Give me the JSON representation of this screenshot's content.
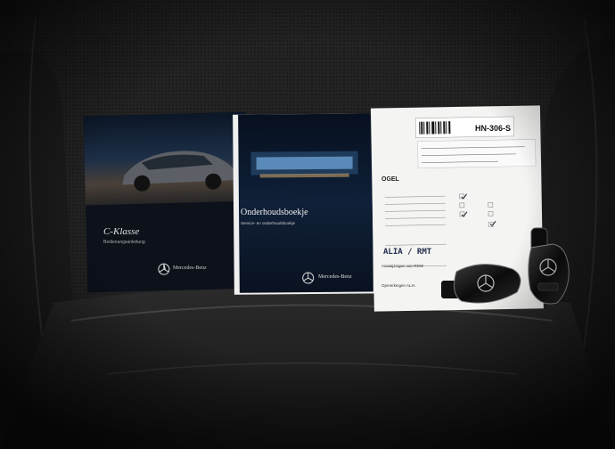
{
  "manual_1": {
    "model": "C-Klasse",
    "subtitle": "Bedienungsanleitung",
    "brand": "Mercedes-Benz"
  },
  "manual_2": {
    "title": "Onderhoudsboekje",
    "subtitle": "Service- en onderhoudsboekje",
    "brand": "Mercedes-Benz"
  },
  "service_card": {
    "plate": "HN-306-S",
    "heading": "OGEL",
    "handwritten_name": "ALIA / RMT",
    "field_1": "Aanwijzingen van RDW",
    "field_2": "Opmerkingen ALIA"
  },
  "colors": {
    "seat": "#1c1c1c",
    "seat_highlight": "#3a3a3a",
    "paper": "#f4f4f2",
    "manual_dark": "#0d1a2a"
  }
}
